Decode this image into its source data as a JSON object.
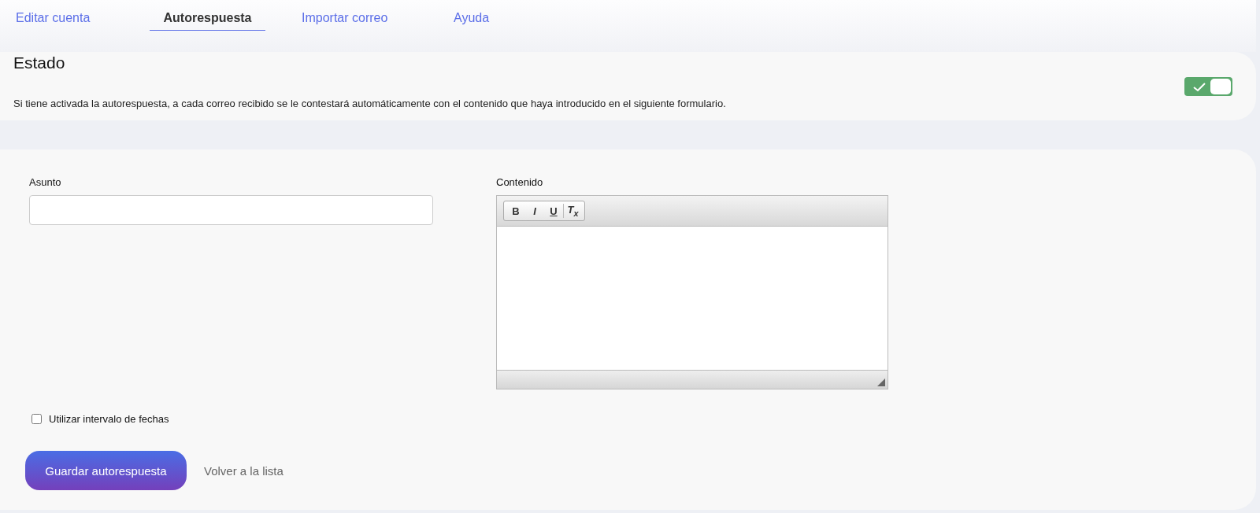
{
  "tabs": [
    {
      "label": "Editar cuenta",
      "selected": false
    },
    {
      "label": "Autorespuesta",
      "selected": true
    },
    {
      "label": "Importar correo",
      "selected": false
    },
    {
      "label": "Ayuda",
      "selected": false
    }
  ],
  "status": {
    "title": "Estado",
    "on": true,
    "description": "Si tiene activada la autorespuesta, a cada correo recibido se le contestará automáticamente con el contenido que haya introducido en el siguiente formulario."
  },
  "form": {
    "subject": {
      "label": "Asunto"
    },
    "content": {
      "label": "Contenido",
      "toolbar": [
        {
          "kind": "bold",
          "label": "B"
        },
        {
          "kind": "italic",
          "label": "I"
        },
        {
          "kind": "underline",
          "label": "U"
        },
        {
          "kind": "clear",
          "label": "T$_{x}$"
        }
      ]
    },
    "date_range": {
      "label": "Utilizar intervalo de fechas",
      "checked": false
    },
    "save_button": "Guardar autorespuesta",
    "back_link": "Volver a la lista"
  }
}
